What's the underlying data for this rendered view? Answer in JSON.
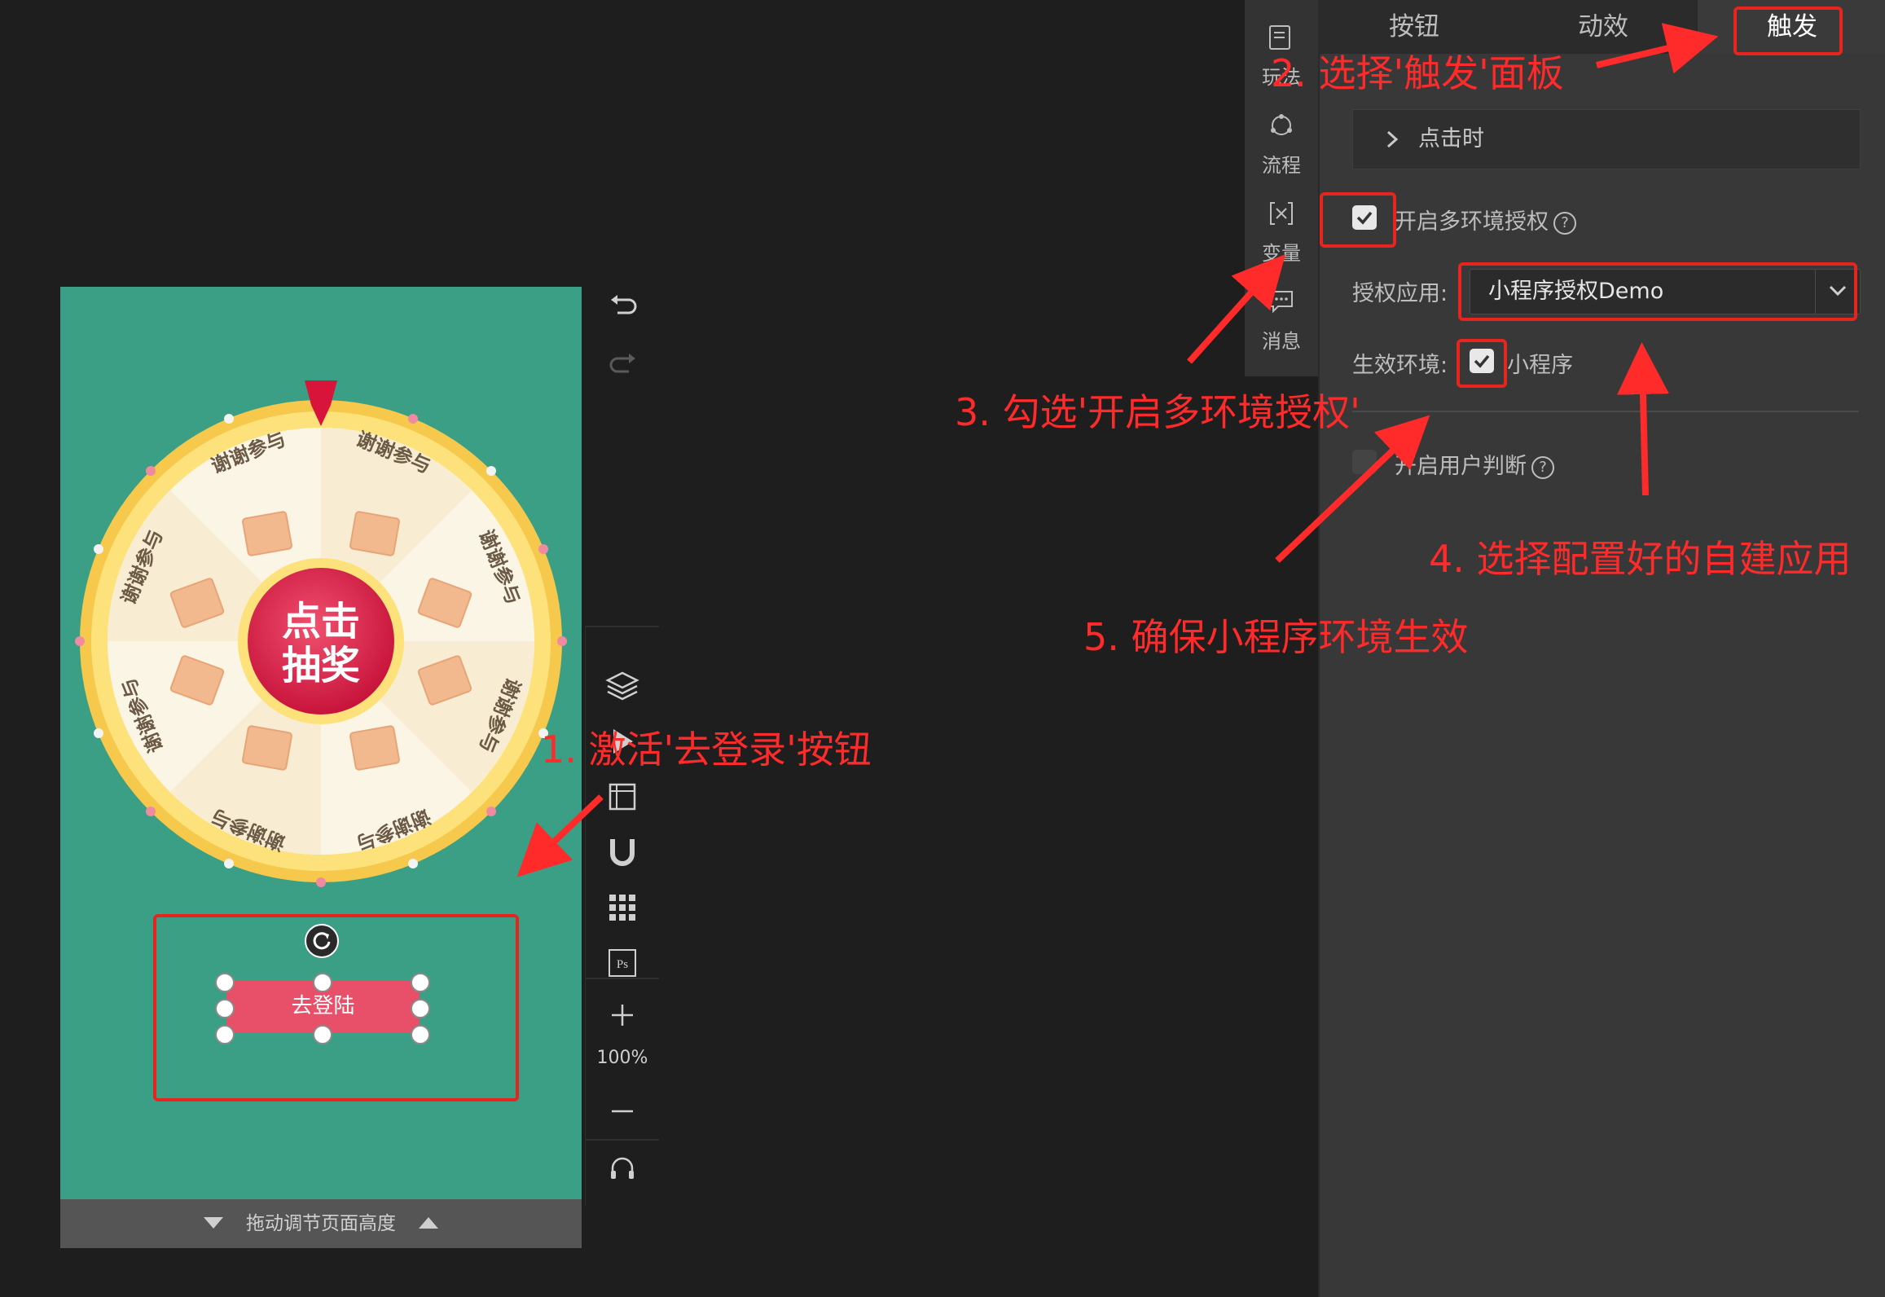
{
  "canvas": {
    "background": "#3b9f85",
    "wheel": {
      "center_line1": "点击",
      "center_line2": "抽奖",
      "sector_labels": [
        "谢谢参与",
        "谢谢参与",
        "谢谢参与",
        "谢谢参与",
        "谢谢参与",
        "谢谢参与",
        "谢谢参与",
        "谢谢参与"
      ]
    },
    "login_button_label": "去登陆",
    "resize_bar_label": "拖动调节页面高度"
  },
  "toolstrip": {
    "zoom_level": "100%",
    "icons": [
      "undo-icon",
      "redo-icon",
      "layers-icon",
      "play-icon",
      "frame-icon",
      "magnet-icon",
      "grid-icon",
      "ps-icon",
      "zoom-in-icon",
      "zoom-out-icon",
      "headset-icon"
    ]
  },
  "side_menu": {
    "items": [
      {
        "label": "玩法",
        "icon": "note-icon"
      },
      {
        "label": "流程",
        "icon": "flow-icon"
      },
      {
        "label": "变量",
        "icon": "variable-icon"
      },
      {
        "label": "消息",
        "icon": "message-icon"
      }
    ]
  },
  "panel": {
    "tabs": [
      {
        "label": "按钮",
        "active": false
      },
      {
        "label": "动效",
        "active": false
      },
      {
        "label": "触发",
        "active": true
      }
    ],
    "trigger_event": "点击时",
    "multi_env_auth": {
      "label": "开启多环境授权",
      "checked": true
    },
    "auth_app": {
      "label": "授权应用:",
      "value": "小程序授权Demo"
    },
    "effective_env": {
      "label": "生效环境:",
      "option": "小程序",
      "checked": true
    },
    "user_judge": {
      "label": "开启用户判断",
      "checked": false
    }
  },
  "annotations": {
    "step1": "1. 激活'去登录'按钮",
    "step2": "2. 选择'触发'面板",
    "step3": "3. 勾选'开启多环境授权'",
    "step4": "4. 选择配置好的自建应用",
    "step5": "5. 确保小程序环境生效",
    "color": "#ff2a2a"
  }
}
